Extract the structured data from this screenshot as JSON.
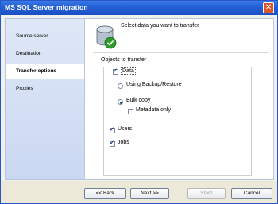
{
  "window": {
    "title": "MS SQL Server migration"
  },
  "sidebar": {
    "items": [
      {
        "label": "Source server"
      },
      {
        "label": "Destination"
      },
      {
        "label": "Transfer options"
      },
      {
        "label": "Proxies"
      }
    ]
  },
  "main": {
    "header": "Select data you want to transfer",
    "objects_label": "Objects to transfer",
    "data_label": "Data",
    "using_backup_label": "Using Backup/Restore",
    "bulk_copy_label": "Bulk copy",
    "metadata_only_label": "Metadata only",
    "users_label": "Users",
    "jobs_label": "Jobs"
  },
  "footer": {
    "back_label": "<< Back",
    "next_label": "Next >>",
    "start_label": "Start!",
    "cancel_label": "Cancel"
  }
}
